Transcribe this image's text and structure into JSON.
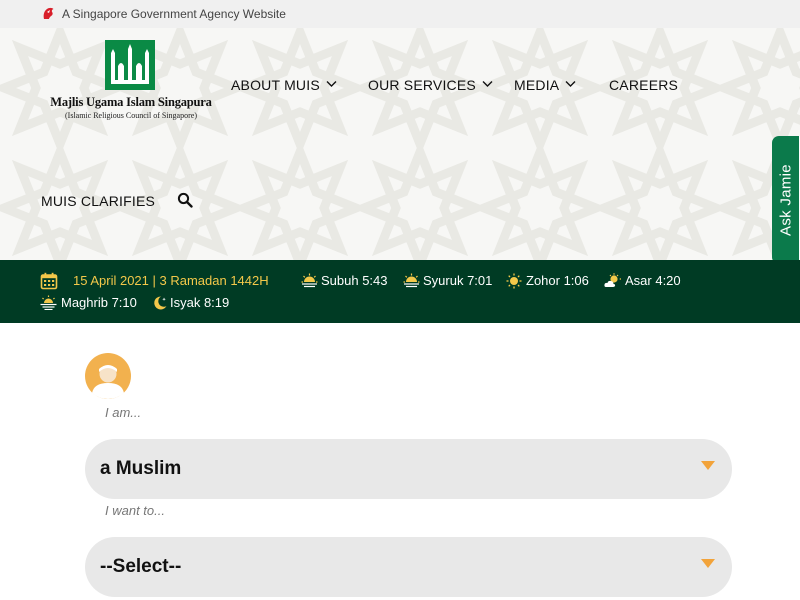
{
  "gov_bar": {
    "text": "A Singapore Government Agency Website",
    "icon": "merlion-lion-icon"
  },
  "logo": {
    "name": "Majlis Ugama Islam Singapura",
    "subtitle": "(Islamic Religious Council of Singapore)",
    "brand_color": "#0a8a45"
  },
  "nav": {
    "about": "ABOUT MUIS",
    "services": "OUR SERVICES",
    "media": "MEDIA",
    "careers": "CAREERS",
    "clarifies": "MUIS CLARIFIES",
    "search_icon": "search-icon"
  },
  "ask_tab": "Ask Jamie",
  "prayer_bar": {
    "date": "15 April 2021 | 3 Ramadan 1442H",
    "times": [
      {
        "label": "Subuh 5:43",
        "icon": "sunrise-icon"
      },
      {
        "label": "Syuruk 7:01",
        "icon": "sunrise-icon"
      },
      {
        "label": "Zohor 1:06",
        "icon": "sun-icon"
      },
      {
        "label": "Asar 4:20",
        "icon": "sun-cloud-icon"
      },
      {
        "label": "Maghrib 7:10",
        "icon": "sunset-icon"
      },
      {
        "label": "Isyak 8:19",
        "icon": "moon-icon"
      }
    ]
  },
  "form": {
    "iam_hint": "I am...",
    "iam_value": "a Muslim",
    "iwant_hint": "I want to...",
    "iwant_value": "--Select--"
  },
  "colors": {
    "prayer_bar_bg": "#003b24",
    "date_text": "#f3c84a",
    "accent_orange": "#f2a33a",
    "ask_tab_bg": "#0b7a4b"
  }
}
